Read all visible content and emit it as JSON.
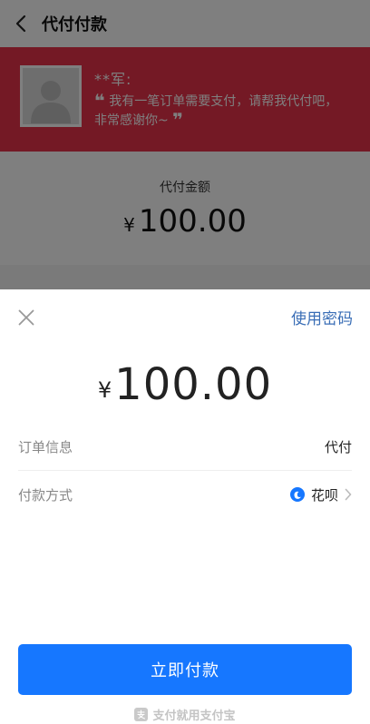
{
  "header": {
    "title": "代付付款"
  },
  "banner": {
    "payer_name": "**军:",
    "quote_open": "❝",
    "message": "我有一笔订单需要支付，请帮我代付吧，非常感谢你~",
    "quote_close": "❞"
  },
  "amount_card": {
    "label": "代付金额",
    "currency": "¥",
    "value": "100.00"
  },
  "sheet": {
    "use_password": "使用密码",
    "currency": "¥",
    "amount": "100.00",
    "order_info_label": "订单信息",
    "order_info_value": "代付",
    "payment_method_label": "付款方式",
    "payment_method_value": "花呗",
    "pay_button": "立即付款",
    "footer_text": "支付就用支付宝"
  },
  "colors": {
    "accent": "#1677ff",
    "banner": "#e8334a",
    "link": "#3a6eb6"
  },
  "icons": [
    "back-arrow-icon",
    "avatar-placeholder-icon",
    "close-icon",
    "huabei-icon",
    "chevron-right-icon",
    "alipay-logo-icon"
  ]
}
